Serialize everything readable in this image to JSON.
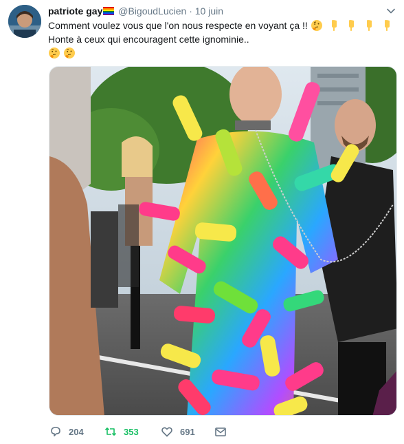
{
  "author": {
    "display_name": "patriote gay",
    "handle": "@BigoudLucien",
    "separator": "·",
    "date": "10 juin",
    "flag_icon": "rainbow-flag-icon"
  },
  "tweet": {
    "line1": "Comment voulez vous que l'on nous respecte en voyant ça !!",
    "line2": "Honte à ceux qui encouragent cette ignominie..",
    "emojis_line1": [
      "thinking-face-icon",
      "pointing-down-icon",
      "pointing-down-icon",
      "pointing-down-icon",
      "pointing-down-icon"
    ],
    "emojis_line3": [
      "thinking-face-icon",
      "thinking-face-icon"
    ]
  },
  "actions": {
    "replies": "204",
    "retweets": "353",
    "likes": "691"
  },
  "colors": {
    "text": "#14171a",
    "secondary": "#657786",
    "retweet_green": "#17bf63",
    "border": "#e6ecf0"
  }
}
